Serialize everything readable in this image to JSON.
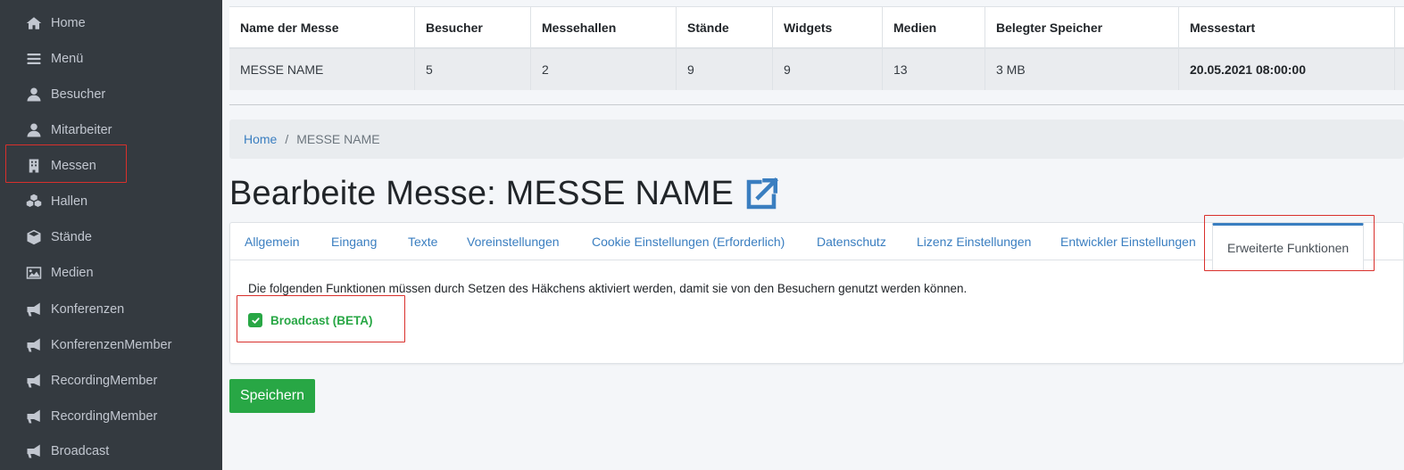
{
  "sidebar": {
    "items": [
      {
        "label": "Home",
        "icon": "home-icon"
      },
      {
        "label": "Menü",
        "icon": "bars-icon"
      },
      {
        "label": "Besucher",
        "icon": "user-icon"
      },
      {
        "label": "Mitarbeiter",
        "icon": "user-icon"
      },
      {
        "label": "Messen",
        "icon": "building-icon"
      },
      {
        "label": "Hallen",
        "icon": "cubes-icon"
      },
      {
        "label": "Stände",
        "icon": "cube-icon"
      },
      {
        "label": "Medien",
        "icon": "image-icon"
      },
      {
        "label": "Konferenzen",
        "icon": "bullhorn-icon"
      },
      {
        "label": "KonferenzenMember",
        "icon": "bullhorn-icon"
      },
      {
        "label": "RecordingMember",
        "icon": "bullhorn-icon"
      },
      {
        "label": "RecordingMember",
        "icon": "bullhorn-icon"
      },
      {
        "label": "Broadcast",
        "icon": "bullhorn-icon"
      }
    ]
  },
  "stats": {
    "headers": [
      "Name der Messe",
      "Besucher",
      "Messehallen",
      "Stände",
      "Widgets",
      "Medien",
      "Belegter Speicher",
      "Messestart"
    ],
    "row": [
      "MESSE NAME",
      "5",
      "2",
      "9",
      "9",
      "13",
      "3 MB",
      "20.05.2021 08:00:00"
    ]
  },
  "breadcrumb": {
    "home": "Home",
    "separator": "/",
    "current": "MESSE NAME"
  },
  "page": {
    "title": "Bearbeite Messe: MESSE NAME"
  },
  "tabs": [
    {
      "label": "Allgemein"
    },
    {
      "label": "Eingang"
    },
    {
      "label": "Texte"
    },
    {
      "label": "Voreinstellungen"
    },
    {
      "label": "Cookie Einstellungen (Erforderlich)"
    },
    {
      "label": "Datenschutz"
    },
    {
      "label": "Lizenz Einstellungen"
    },
    {
      "label": "Entwickler Einstellungen"
    },
    {
      "label": "Erweiterte Funktionen"
    }
  ],
  "card": {
    "description": "Die folgenden Funktionen müssen durch Setzen des Häkchens aktiviert werden, damit sie von den Besuchern genutzt werden können.",
    "checkbox_label": "Broadcast (BETA)",
    "checkbox_checked": true
  },
  "actions": {
    "save_label": "Speichern"
  },
  "colors": {
    "sidebar_bg": "#343a40",
    "accent": "#3a7ec0",
    "success": "#28a745",
    "highlight": "#d9302c"
  }
}
